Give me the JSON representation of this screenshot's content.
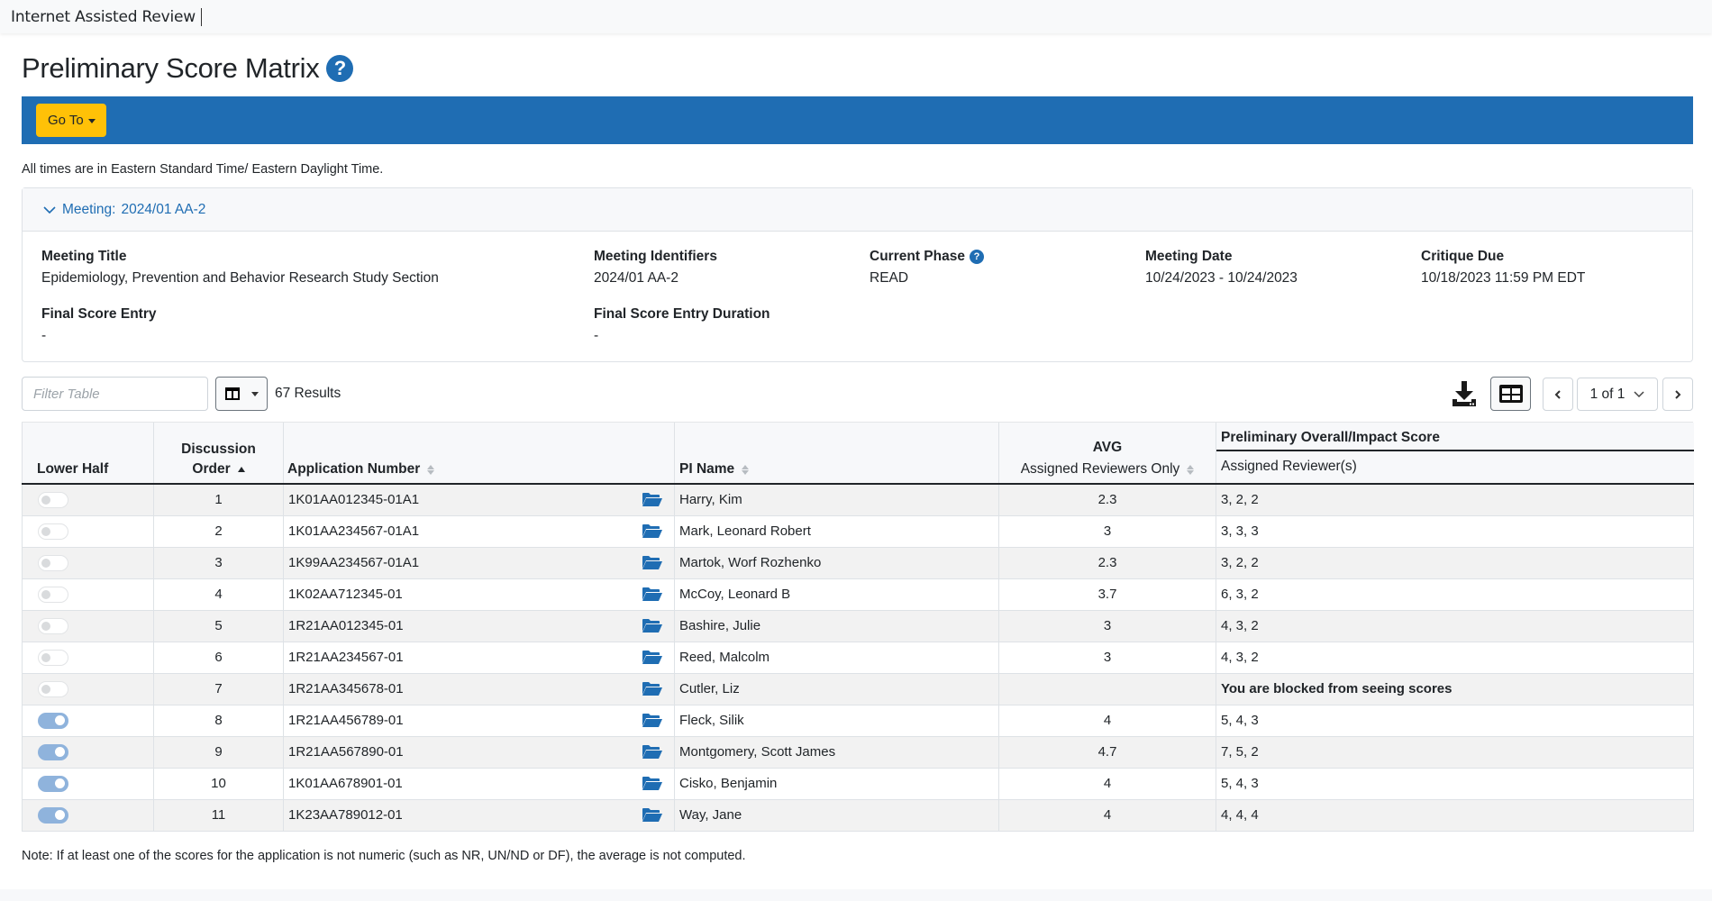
{
  "app": {
    "name": "Internet Assisted Review"
  },
  "page": {
    "title": "Preliminary Score Matrix",
    "help_icon": "question-circle-icon"
  },
  "toolbar": {
    "goto_label": "Go To"
  },
  "timezone_note": "All times are in Eastern Standard Time/ Eastern Daylight Time.",
  "meeting": {
    "header_label": "Meeting:",
    "header_value": "2024/01 AA-2",
    "fields": {
      "title": {
        "label": "Meeting Title",
        "value": "Epidemiology, Prevention and Behavior Research Study Section"
      },
      "identifiers": {
        "label": "Meeting Identifiers",
        "value": "2024/01 AA-2"
      },
      "phase": {
        "label": "Current Phase",
        "value": "READ"
      },
      "date": {
        "label": "Meeting Date",
        "value": "10/24/2023 - 10/24/2023"
      },
      "critique_due": {
        "label": "Critique Due",
        "value": "10/18/2023 11:59 PM EDT"
      },
      "final_score_entry": {
        "label": "Final Score Entry",
        "value": "-"
      },
      "final_score_duration": {
        "label": "Final Score Entry Duration",
        "value": "-"
      }
    }
  },
  "table_controls": {
    "filter_placeholder": "Filter Table",
    "results": "67 Results",
    "pagination": {
      "current": "1 of 1"
    }
  },
  "table": {
    "headers": {
      "lower_half": "Lower Half",
      "discussion_order_line1": "Discussion",
      "discussion_order_line2": "Order",
      "application_number": "Application Number",
      "pi_name": "PI Name",
      "avg_title": "AVG",
      "avg_sub": "Assigned Reviewers Only",
      "score_title": "Preliminary Overall/Impact Score",
      "score_sub": "Assigned Reviewer(s)"
    },
    "sort": {
      "column": "discussion_order",
      "direction": "ascending"
    },
    "rows": [
      {
        "lower_half": false,
        "order": "1",
        "app": "1K01AA012345-01A1",
        "pi": "Harry, Kim",
        "avg": "2.3",
        "scores": "3, 2, 2",
        "blocked": false
      },
      {
        "lower_half": false,
        "order": "2",
        "app": "1K01AA234567-01A1",
        "pi": "Mark, Leonard Robert",
        "avg": "3",
        "scores": "3, 3, 3",
        "blocked": false
      },
      {
        "lower_half": false,
        "order": "3",
        "app": "1K99AA234567-01A1",
        "pi": "Martok, Worf Rozhenko",
        "avg": "2.3",
        "scores": "3, 2, 2",
        "blocked": false
      },
      {
        "lower_half": false,
        "order": "4",
        "app": "1K02AA712345-01",
        "pi": "McCoy, Leonard B",
        "avg": "3.7",
        "scores": "6, 3, 2",
        "blocked": false
      },
      {
        "lower_half": false,
        "order": "5",
        "app": "1R21AA012345-01",
        "pi": "Bashire, Julie",
        "avg": "3",
        "scores": "4, 3, 2",
        "blocked": false
      },
      {
        "lower_half": false,
        "order": "6",
        "app": "1R21AA234567-01",
        "pi": "Reed, Malcolm",
        "avg": "3",
        "scores": "4, 3, 2",
        "blocked": false
      },
      {
        "lower_half": false,
        "order": "7",
        "app": "1R21AA345678-01",
        "pi": "Cutler, Liz",
        "avg": "",
        "scores": "You are blocked from seeing scores",
        "blocked": true
      },
      {
        "lower_half": true,
        "order": "8",
        "app": "1R21AA456789-01",
        "pi": "Fleck, Silik",
        "avg": "4",
        "scores": "5, 4, 3",
        "blocked": false
      },
      {
        "lower_half": true,
        "order": "9",
        "app": "1R21AA567890-01",
        "pi": "Montgomery, Scott James",
        "avg": "4.7",
        "scores": "7, 5, 2",
        "blocked": false
      },
      {
        "lower_half": true,
        "order": "10",
        "app": "1K01AA678901-01",
        "pi": "Cisko, Benjamin",
        "avg": "4",
        "scores": "5, 4, 3",
        "blocked": false
      },
      {
        "lower_half": true,
        "order": "11",
        "app": "1K23AA789012-01",
        "pi": "Way, Jane",
        "avg": "4",
        "scores": "4, 4, 4",
        "blocked": false
      }
    ]
  },
  "footnote": "Note: If at least one of the scores for the application is not numeric (such as NR, UN/ND or DF), the average is not computed.",
  "colors": {
    "brand_blue": "#1f6db3",
    "goto_yellow": "#ffc107",
    "toggle_on": "#8fb3dc",
    "row_stripe": "#f2f2f2"
  }
}
